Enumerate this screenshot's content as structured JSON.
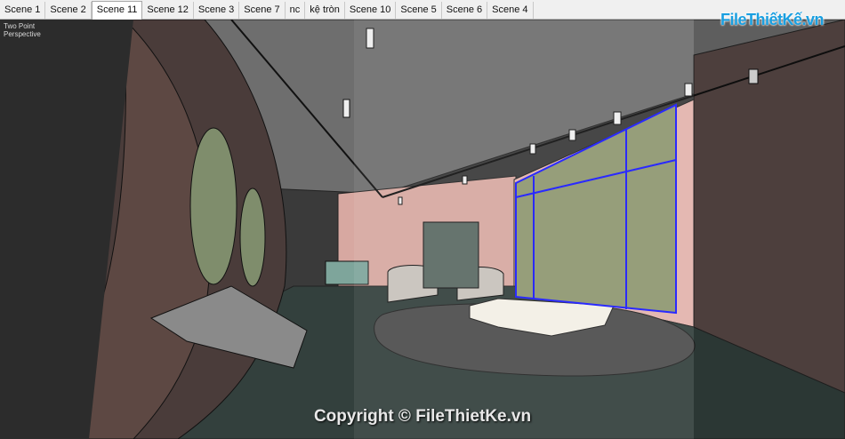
{
  "tabs": [
    {
      "label": "Scene 1",
      "active": false
    },
    {
      "label": "Scene 2",
      "active": false
    },
    {
      "label": "Scene 11",
      "active": true
    },
    {
      "label": "Scene 12",
      "active": false
    },
    {
      "label": "Scene 3",
      "active": false
    },
    {
      "label": "Scene 7",
      "active": false
    },
    {
      "label": "nc",
      "active": false
    },
    {
      "label": "kệ tròn",
      "active": false
    },
    {
      "label": "Scene 10",
      "active": false
    },
    {
      "label": "Scene 5",
      "active": false
    },
    {
      "label": "Scene 6",
      "active": false
    },
    {
      "label": "Scene 4",
      "active": false
    }
  ],
  "viewport": {
    "camera_label_line1": "Two Point",
    "camera_label_line2": "Perspective"
  },
  "watermark": {
    "text": "Copyright © FileThietKe.vn"
  },
  "logo": {
    "text": "FileThiếtKế.vn"
  },
  "colors": {
    "selection_blue": "#1a1aff",
    "pink_wall": "#e2b3ad",
    "green_panel": "#8f9770",
    "floor_dark": "#33403d",
    "logo_blue": "#1a9fe0"
  }
}
